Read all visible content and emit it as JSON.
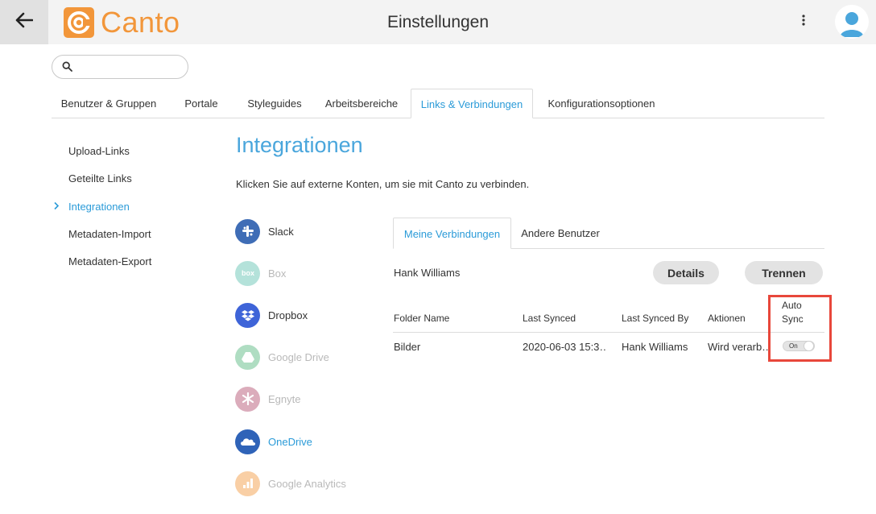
{
  "header": {
    "logo_text": "Canto",
    "title": "Einstellungen",
    "brand_color": "#f2963a"
  },
  "search": {
    "placeholder": "",
    "value": ""
  },
  "tabs": [
    {
      "label": "Benutzer & Gruppen",
      "active": false
    },
    {
      "label": "Portale",
      "active": false
    },
    {
      "label": "Styleguides",
      "active": false
    },
    {
      "label": "Arbeitsbereiche",
      "active": false
    },
    {
      "label": "Links & Verbindungen",
      "active": true
    },
    {
      "label": "Konfigurationsoptionen",
      "active": false
    }
  ],
  "sidebar": {
    "items": [
      {
        "label": "Upload-Links",
        "active": false
      },
      {
        "label": "Geteilte Links",
        "active": false
      },
      {
        "label": "Integrationen",
        "active": true
      },
      {
        "label": "Metadaten-Import",
        "active": false
      },
      {
        "label": "Metadaten-Export",
        "active": false
      }
    ]
  },
  "main": {
    "title": "Integrationen",
    "subtitle": "Klicken Sie auf externe Konten, um sie mit Canto zu verbinden."
  },
  "services": [
    {
      "label": "Slack",
      "icon": "slack-icon",
      "color": "#3f6db6",
      "state": "normal"
    },
    {
      "label": "Box",
      "icon": "box-icon",
      "color": "#5bbfae",
      "state": "faded"
    },
    {
      "label": "Dropbox",
      "icon": "dropbox-icon",
      "color": "#3e64d8",
      "state": "normal"
    },
    {
      "label": "Google Drive",
      "icon": "google-drive-icon",
      "color": "#4fb57a",
      "state": "faded"
    },
    {
      "label": "Egnyte",
      "icon": "egnyte-icon",
      "color": "#b0486a",
      "state": "faded"
    },
    {
      "label": "OneDrive",
      "icon": "onedrive-icon",
      "color": "#2f63b8",
      "state": "active"
    },
    {
      "label": "Google Analytics",
      "icon": "google-analytics-icon",
      "color": "#f2963a",
      "state": "faded"
    }
  ],
  "connections": {
    "tabs": [
      {
        "label": "Meine Verbindungen",
        "active": true
      },
      {
        "label": "Andere Benutzer",
        "active": false
      }
    ],
    "user": "Hank Williams",
    "details_label": "Details",
    "disconnect_label": "Trennen",
    "columns": {
      "folder": "Folder Name",
      "last_synced": "Last Synced",
      "last_synced_by": "Last Synced By",
      "actions": "Aktionen",
      "auto_sync_line1": "Auto",
      "auto_sync_line2": "Sync"
    },
    "rows": [
      {
        "folder": "Bilder",
        "last_synced": "2020-06-03 15:3…",
        "last_synced_by": "Hank Williams",
        "actions": "Wird verarb…",
        "auto_sync": "On"
      }
    ]
  },
  "colors": {
    "accent": "#2b9bd8",
    "highlight": "#e8473b"
  }
}
